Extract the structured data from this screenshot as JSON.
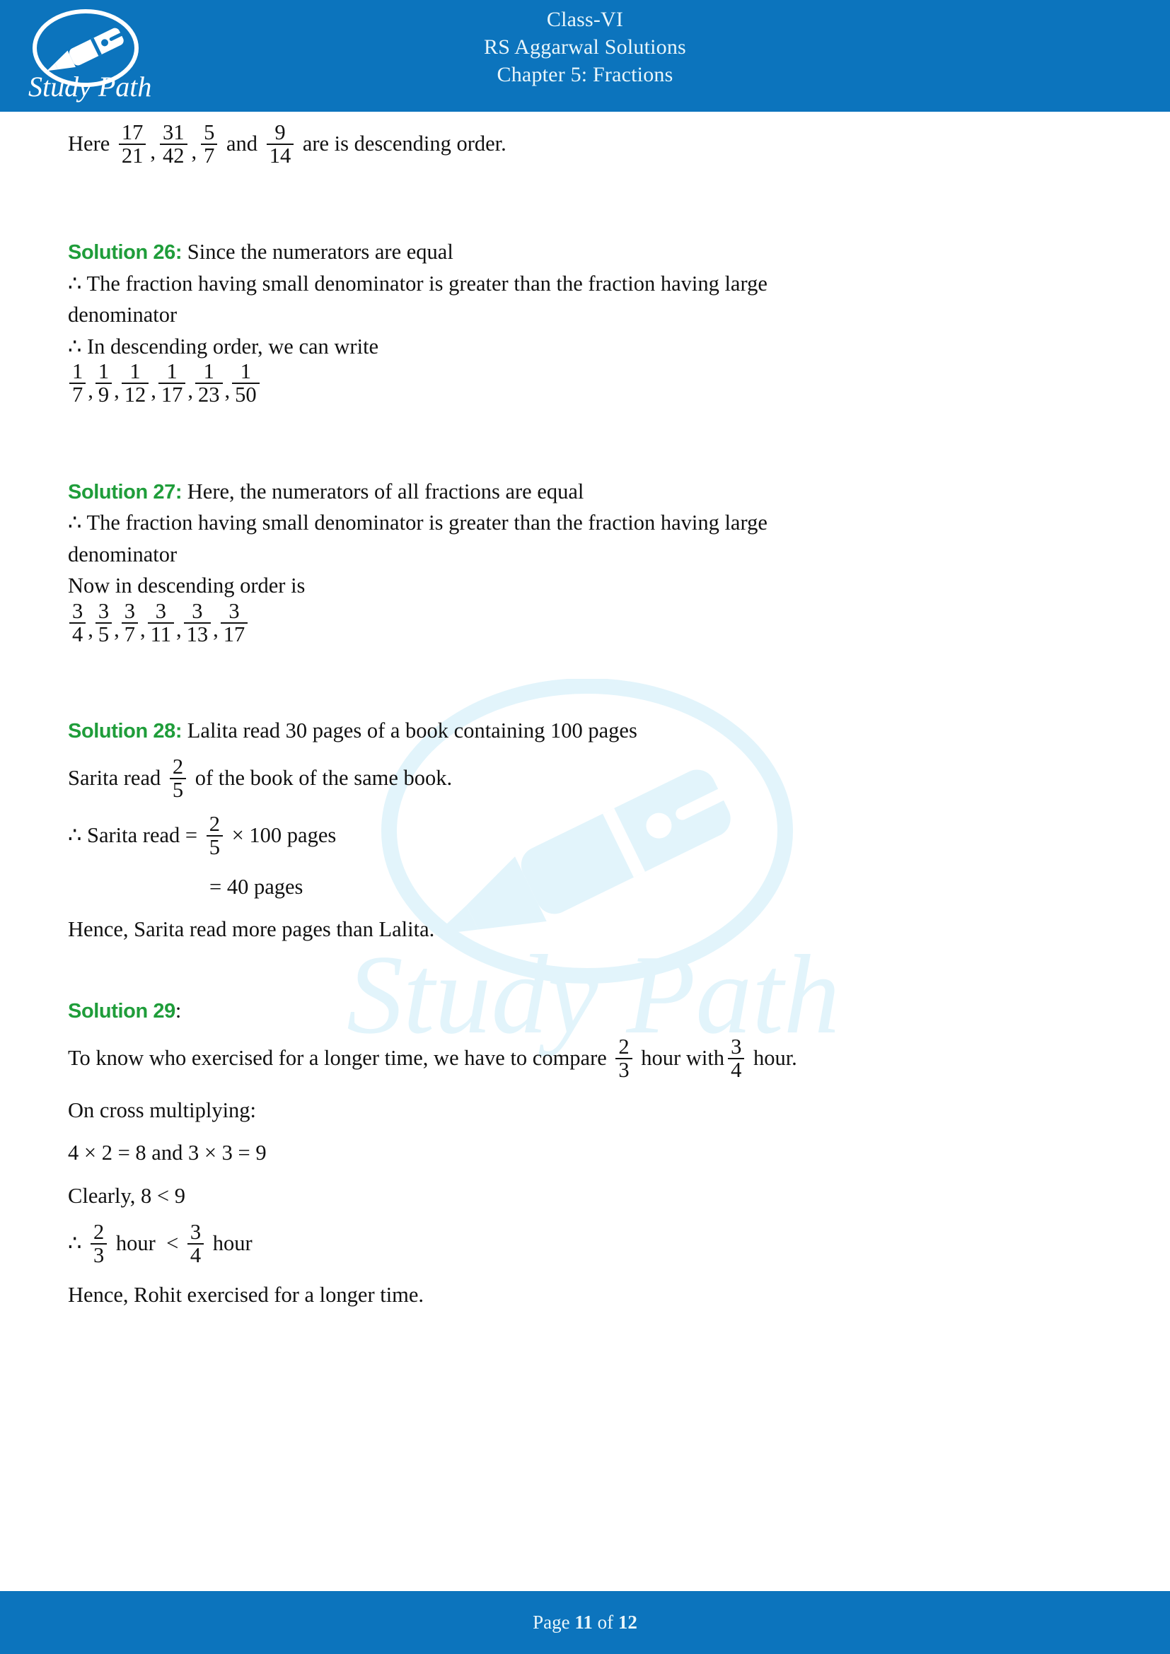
{
  "header": {
    "logo_text": "Study Path",
    "logo_icon": "fountain-pen-icon",
    "line1": "Class-VI",
    "line2": "RS Aggarwal Solutions",
    "line3": "Chapter 5: Fractions",
    "background_color": "#0c74bd",
    "text_color": "#e9f6fb"
  },
  "watermark": {
    "text": "Study Path",
    "color": "#e2f4fb"
  },
  "colors": {
    "accent_blue": "#0c74bd",
    "solution_green": "#1f9d3a",
    "body_text": "#111111"
  },
  "content": {
    "intro": {
      "prefix": "Here",
      "fractions": [
        {
          "num": "17",
          "den": "21"
        },
        {
          "num": "31",
          "den": "42"
        },
        {
          "num": "5",
          "den": "7"
        }
      ],
      "conjunction": "and",
      "last_fraction": {
        "num": "9",
        "den": "14"
      },
      "suffix": "are is descending order."
    },
    "solution26": {
      "label": "Solution 26:",
      "line1": "Since the numerators are equal",
      "line2": "∴ The fraction having small denominator is greater than the fraction having large",
      "line3": "denominator",
      "line4": "∴  In descending order, we can write",
      "fractions": [
        {
          "num": "1",
          "den": "7"
        },
        {
          "num": "1",
          "den": "9"
        },
        {
          "num": "1",
          "den": "12"
        },
        {
          "num": "1",
          "den": "17"
        },
        {
          "num": "1",
          "den": "23"
        },
        {
          "num": "1",
          "den": "50"
        }
      ]
    },
    "solution27": {
      "label": "Solution 27:",
      "line1": "Here, the numerators of all fractions are equal",
      "line2": "∴ The fraction having small denominator is greater than the fraction having large",
      "line3": "denominator",
      "line4": "Now in descending order is",
      "fractions": [
        {
          "num": "3",
          "den": "4"
        },
        {
          "num": "3",
          "den": "5"
        },
        {
          "num": "3",
          "den": "7"
        },
        {
          "num": "3",
          "den": "11"
        },
        {
          "num": "3",
          "den": "13"
        },
        {
          "num": "3",
          "den": "17"
        }
      ]
    },
    "solution28": {
      "label": "Solution 28:",
      "line1": "Lalita read 30 pages of a book containing 100 pages",
      "line2_prefix": "Sarita read",
      "line2_fraction": {
        "num": "2",
        "den": "5"
      },
      "line2_suffix": "of the book of the same book.",
      "line3_prefix": "∴ Sarita read =",
      "line3_fraction": {
        "num": "2",
        "den": "5"
      },
      "line3_suffix": "× 100 pages",
      "line4": "= 40 pages",
      "line5": "Hence, Sarita read more pages than Lalita."
    },
    "solution29": {
      "label": "Solution 29",
      "label_colon": ":",
      "line1_prefix": "To know who exercised for a longer time, we have to compare",
      "line1_fraction1": {
        "num": "2",
        "den": "3"
      },
      "line1_mid": "hour with",
      "line1_fraction2": {
        "num": "3",
        "den": "4"
      },
      "line1_suffix": "hour.",
      "line2": "On cross multiplying:",
      "line3": "4 × 2 = 8 and 3 × 3 = 9",
      "line4": "Clearly, 8 < 9",
      "line5_prefix": "∴",
      "line5_fraction1": {
        "num": "2",
        "den": "3"
      },
      "line5_mid1": "hour",
      "line5_lt": "<",
      "line5_fraction2": {
        "num": "3",
        "den": "4"
      },
      "line5_mid2": "hour",
      "line6": "Hence, Rohit exercised for a longer time."
    }
  },
  "footer": {
    "page_word": "Page",
    "page_number": "11",
    "of_word": "of",
    "total_pages": "12",
    "background_color": "#0c74bd",
    "text_color": "#e9f6fb"
  }
}
